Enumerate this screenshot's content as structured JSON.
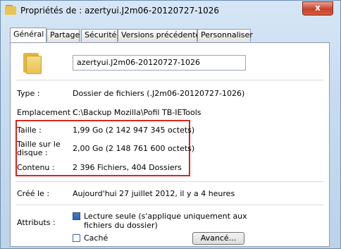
{
  "window": {
    "title": "Propriétés de : azertyui.J2m06-20120727-1026",
    "close_label": "x"
  },
  "tabs": [
    {
      "label": "Général",
      "active": true
    },
    {
      "label": "Partage",
      "active": false
    },
    {
      "label": "Sécurité",
      "active": false
    },
    {
      "label": "Versions précédentes",
      "active": false
    },
    {
      "label": "Personnaliser",
      "active": false
    }
  ],
  "general": {
    "folder_name": "azertyui.J2m06-20120727-1026",
    "type": {
      "label": "Type :",
      "value": "Dossier de fichiers (.J2m06-20120727-1026)"
    },
    "location": {
      "label": "Emplacement :",
      "value": "C:\\Backup Mozilla\\Pofil TB-IETools"
    },
    "size": {
      "label": "Taille :",
      "value": "1,99 Go (2 142 947 345 octets)"
    },
    "size_on_disk": {
      "label_line1": "Taille sur le",
      "label_line2": "disque :",
      "value": "2,00 Go (2 148 761 600 octets)"
    },
    "contents": {
      "label": "Contenu :",
      "value": "2 396 Fichiers, 404 Dossiers"
    },
    "created": {
      "label": "Créé le :",
      "value": "Aujourd'hui 27 juillet 2012, il y a 4 heures"
    },
    "attributes": {
      "label": "Attributs :",
      "readonly_line1": "Lecture seule (s'applique uniquement aux",
      "readonly_line2": "fichiers du dossier)",
      "readonly_checked": true,
      "hidden": "Caché",
      "hidden_checked": false,
      "advanced_button": "Avancé..."
    }
  },
  "colors": {
    "highlight_box": "#d9251d",
    "accent": "#2b64b0"
  }
}
